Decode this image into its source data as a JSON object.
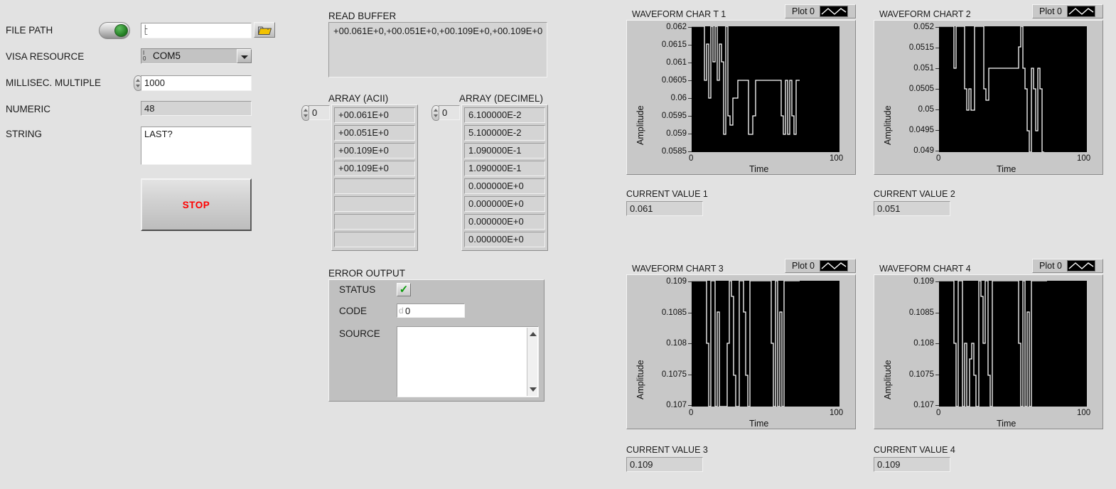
{
  "window": {
    "background": "#e2e2e2"
  },
  "left_panel": {
    "labels": {
      "file_path": "FILE PATH",
      "visa_resource": "VISA RESOURCE",
      "millisec_multiple": "MILLISEC. MULTIPLE",
      "numeric": "NUMERIC",
      "string": "STRING"
    },
    "file_path_value": "",
    "file_path_placeholder": "",
    "enable_switch_state": "on",
    "browse_icon": "folder-icon",
    "visa_resource_value": "COM5",
    "visa_resource_options": [
      "COM5"
    ],
    "millisec_multiple_value": "1000",
    "numeric_value": "48",
    "string_value": "LAST?",
    "stop_button_label": "STOP",
    "stop_button_color": "#ff0000"
  },
  "center_panel": {
    "read_buffer": {
      "label": "READ BUFFER",
      "value": "+00.061E+0,+00.051E+0,+00.109E+0,+00.109E+0"
    },
    "array_ascii": {
      "label": "ARRAY (ACII)",
      "index": "0",
      "cells": [
        "+00.061E+0",
        "+00.051E+0",
        "+00.109E+0",
        "+00.109E+0",
        "",
        "",
        "",
        ""
      ]
    },
    "array_decimal": {
      "label": "ARRAY (DECIMEL)",
      "index": "0",
      "cells": [
        "6.100000E-2",
        "5.100000E-2",
        "1.090000E-1",
        "1.090000E-1",
        "0.000000E+0",
        "0.000000E+0",
        "0.000000E+0",
        "0.000000E+0"
      ],
      "dim_from_index": 4
    },
    "error_output": {
      "label": "ERROR OUTPUT",
      "status_label": "STATUS",
      "status_value": "ok",
      "status_glyph": "check-icon",
      "status_color": "#0a9b0a",
      "code_label": "CODE",
      "code_prefix": "d",
      "code_value": "0",
      "source_label": "SOURCE",
      "source_value": ""
    }
  },
  "charts": [
    {
      "title": "WAVEFORM CHAR T 1",
      "legend_label": "Plot 0",
      "current_value_label": "CURRENT VALUE 1",
      "current_value": "0.061"
    },
    {
      "title": "WAVEFORM CHART 2",
      "legend_label": "Plot 0",
      "current_value_label": "CURRENT VALUE 2",
      "current_value": "0.051"
    },
    {
      "title": "WAVEFORM CHART 3",
      "legend_label": "Plot 0",
      "current_value_label": "CURRENT VALUE 3",
      "current_value": "0.109"
    },
    {
      "title": "WAVEFORM CHART 4",
      "legend_label": "Plot 0",
      "current_value_label": "CURRENT VALUE 4",
      "current_value": "0.109"
    }
  ],
  "chart_data": [
    {
      "type": "line",
      "title": "WAVEFORM CHAR T 1",
      "xlabel": "Time",
      "ylabel": "Amplitude",
      "xlim": [
        0,
        100
      ],
      "ylim": [
        0.0585,
        0.062
      ],
      "xticks": [
        "0",
        "100"
      ],
      "yticks": [
        "0.0585",
        "0.059",
        "0.0595",
        "0.06",
        "0.0605",
        "0.061",
        "0.0615",
        "0.062"
      ],
      "grid": false,
      "legend": [
        "Plot 0"
      ],
      "legend_position": "top-right",
      "plot_color": "#ffffff",
      "plot_background": "#000000",
      "x": [
        0,
        1,
        2,
        3,
        4,
        5,
        6,
        7,
        8,
        9,
        10,
        11,
        12,
        13,
        14,
        15,
        16,
        17,
        18,
        19,
        20,
        21,
        22,
        23,
        24,
        25,
        26,
        27,
        28,
        29,
        30,
        31,
        32,
        33,
        34,
        35,
        36,
        37,
        38,
        39,
        40
      ],
      "values": [
        0.062,
        0.062,
        0.062,
        0.062,
        0.062,
        0.0615,
        0.06,
        0.0615,
        0.062,
        0.0605,
        0.062,
        0.0605,
        0.062,
        0.061,
        0.0605,
        0.059,
        0.062,
        0.0595,
        0.0593,
        0.0605,
        0.0605,
        0.061,
        0.061,
        0.059,
        0.0595,
        0.061,
        0.061,
        0.061,
        0.061,
        0.061,
        0.061,
        0.0595,
        0.059,
        0.061,
        0.059,
        0.061,
        0.0595,
        0.059,
        0.061,
        0.061,
        0.061
      ]
    },
    {
      "type": "line",
      "title": "WAVEFORM CHART 2",
      "xlabel": "Time",
      "ylabel": "Amplitude",
      "xlim": [
        0,
        100
      ],
      "ylim": [
        0.049,
        0.052
      ],
      "xticks": [
        "0",
        "100"
      ],
      "yticks": [
        "0.049",
        "0.0495",
        "0.05",
        "0.0505",
        "0.051",
        "0.0515",
        "0.052"
      ],
      "grid": false,
      "legend": [
        "Plot 0"
      ],
      "legend_position": "top-right",
      "plot_color": "#ffffff",
      "plot_background": "#000000",
      "x": [
        0,
        1,
        2,
        3,
        4,
        5,
        6,
        7,
        8,
        9,
        10,
        11,
        12,
        13,
        14,
        15,
        16,
        17,
        18,
        19,
        20,
        21,
        22,
        23,
        24,
        25,
        26,
        27,
        28,
        29,
        30,
        31,
        32,
        33,
        34,
        35,
        36,
        37,
        38,
        39,
        40
      ],
      "values": [
        0.052,
        0.052,
        0.052,
        0.052,
        0.052,
        0.051,
        0.0515,
        0.052,
        0.052,
        0.0505,
        0.05,
        0.0505,
        0.05,
        0.052,
        0.052,
        0.0505,
        0.05,
        0.0505,
        0.051,
        0.051,
        0.051,
        0.051,
        0.0515,
        0.052,
        0.049,
        0.0495,
        0.051,
        0.0505,
        0.0495,
        0.051,
        0.0505,
        0.049,
        0.051,
        0.0505,
        0.049
      ]
    },
    {
      "type": "line",
      "title": "WAVEFORM CHART 3",
      "xlabel": "Time",
      "ylabel": "Amplitude",
      "xlim": [
        0,
        100
      ],
      "ylim": [
        0.107,
        0.109
      ],
      "xticks": [
        "0",
        "100"
      ],
      "yticks": [
        "0.107",
        "0.1075",
        "0.108",
        "0.1085",
        "0.109"
      ],
      "grid": false,
      "legend": [
        "Plot 0"
      ],
      "legend_position": "top-right",
      "plot_color": "#ffffff",
      "plot_background": "#000000",
      "x": [
        0,
        1,
        2,
        3,
        4,
        5,
        6,
        7,
        8,
        9,
        10,
        11,
        12,
        13,
        14,
        15,
        16,
        17,
        18,
        19,
        20,
        21,
        22,
        23,
        24,
        25,
        26,
        27,
        28,
        29,
        30,
        31,
        32,
        33,
        34,
        35,
        36,
        37,
        38,
        39,
        40
      ],
      "values": [
        0.109,
        0.109,
        0.109,
        0.109,
        0.109,
        0.1075,
        0.107,
        0.1085,
        0.109,
        0.107,
        0.1075,
        0.107,
        0.1085,
        0.109,
        0.1073,
        0.107,
        0.108,
        0.1087,
        0.109,
        0.107,
        0.1075,
        0.1085,
        0.109,
        0.109,
        0.109,
        0.109,
        0.109,
        0.1075,
        0.107,
        0.1085,
        0.107,
        0.1085,
        0.107,
        0.1075,
        0.109,
        0.109,
        0.109
      ]
    },
    {
      "type": "line",
      "title": "WAVEFORM CHART 4",
      "xlabel": "Time",
      "ylabel": "Amplitude",
      "xlim": [
        0,
        100
      ],
      "ylim": [
        0.107,
        0.109
      ],
      "xticks": [
        "0",
        "100"
      ],
      "yticks": [
        "0.107",
        "0.1075",
        "0.108",
        "0.1085",
        "0.109"
      ],
      "grid": false,
      "legend": [
        "Plot 0"
      ],
      "legend_position": "top-right",
      "plot_color": "#ffffff",
      "plot_background": "#000000",
      "x": [
        0,
        1,
        2,
        3,
        4,
        5,
        6,
        7,
        8,
        9,
        10,
        11,
        12,
        13,
        14,
        15,
        16,
        17,
        18,
        19,
        20,
        21,
        22,
        23,
        24,
        25,
        26,
        27,
        28,
        29,
        30,
        31,
        32,
        33,
        34,
        35,
        36,
        37,
        38,
        39,
        40
      ],
      "values": [
        0.109,
        0.109,
        0.109,
        0.109,
        0.109,
        0.1075,
        0.107,
        0.1085,
        0.109,
        0.107,
        0.1073,
        0.108,
        0.1078,
        0.107,
        0.1085,
        0.109,
        0.1087,
        0.109,
        0.1073,
        0.107,
        0.1085,
        0.109,
        0.109,
        0.109,
        0.109,
        0.109,
        0.1075,
        0.107,
        0.1085,
        0.107,
        0.1085,
        0.107,
        0.1075,
        0.109,
        0.109,
        0.109
      ]
    }
  ]
}
